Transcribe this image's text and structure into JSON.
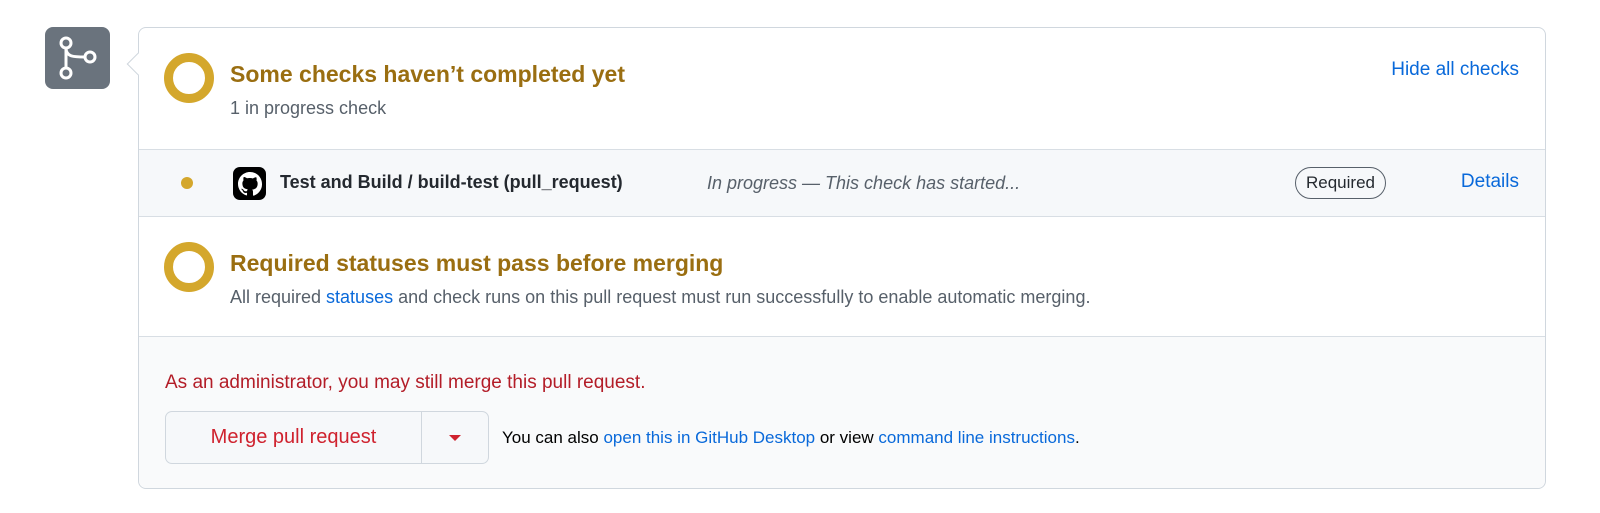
{
  "status": {
    "title": "Some checks haven’t completed yet",
    "subtitle": "1 in progress check",
    "toggle": "Hide all checks"
  },
  "check": {
    "name": "Test and Build / build-test (pull_request)",
    "description": "In progress — This check has started...",
    "badge": "Required",
    "details": "Details"
  },
  "required": {
    "title": "Required statuses must pass before merging",
    "text_before": "All required ",
    "link": "statuses",
    "text_after": " and check runs on this pull request must run successfully to enable automatic merging."
  },
  "merge": {
    "warning": "As an administrator, you may still merge this pull request.",
    "button": "Merge pull request",
    "also_before": "You can also ",
    "desktop_link": "open this in GitHub Desktop",
    "also_middle": " or view ",
    "cli_link": "command line instructions",
    "also_after": "."
  },
  "colors": {
    "pending": "#d4a72c",
    "pending_text": "#9a6e11",
    "danger": "#cf222e",
    "link": "#0969da"
  }
}
